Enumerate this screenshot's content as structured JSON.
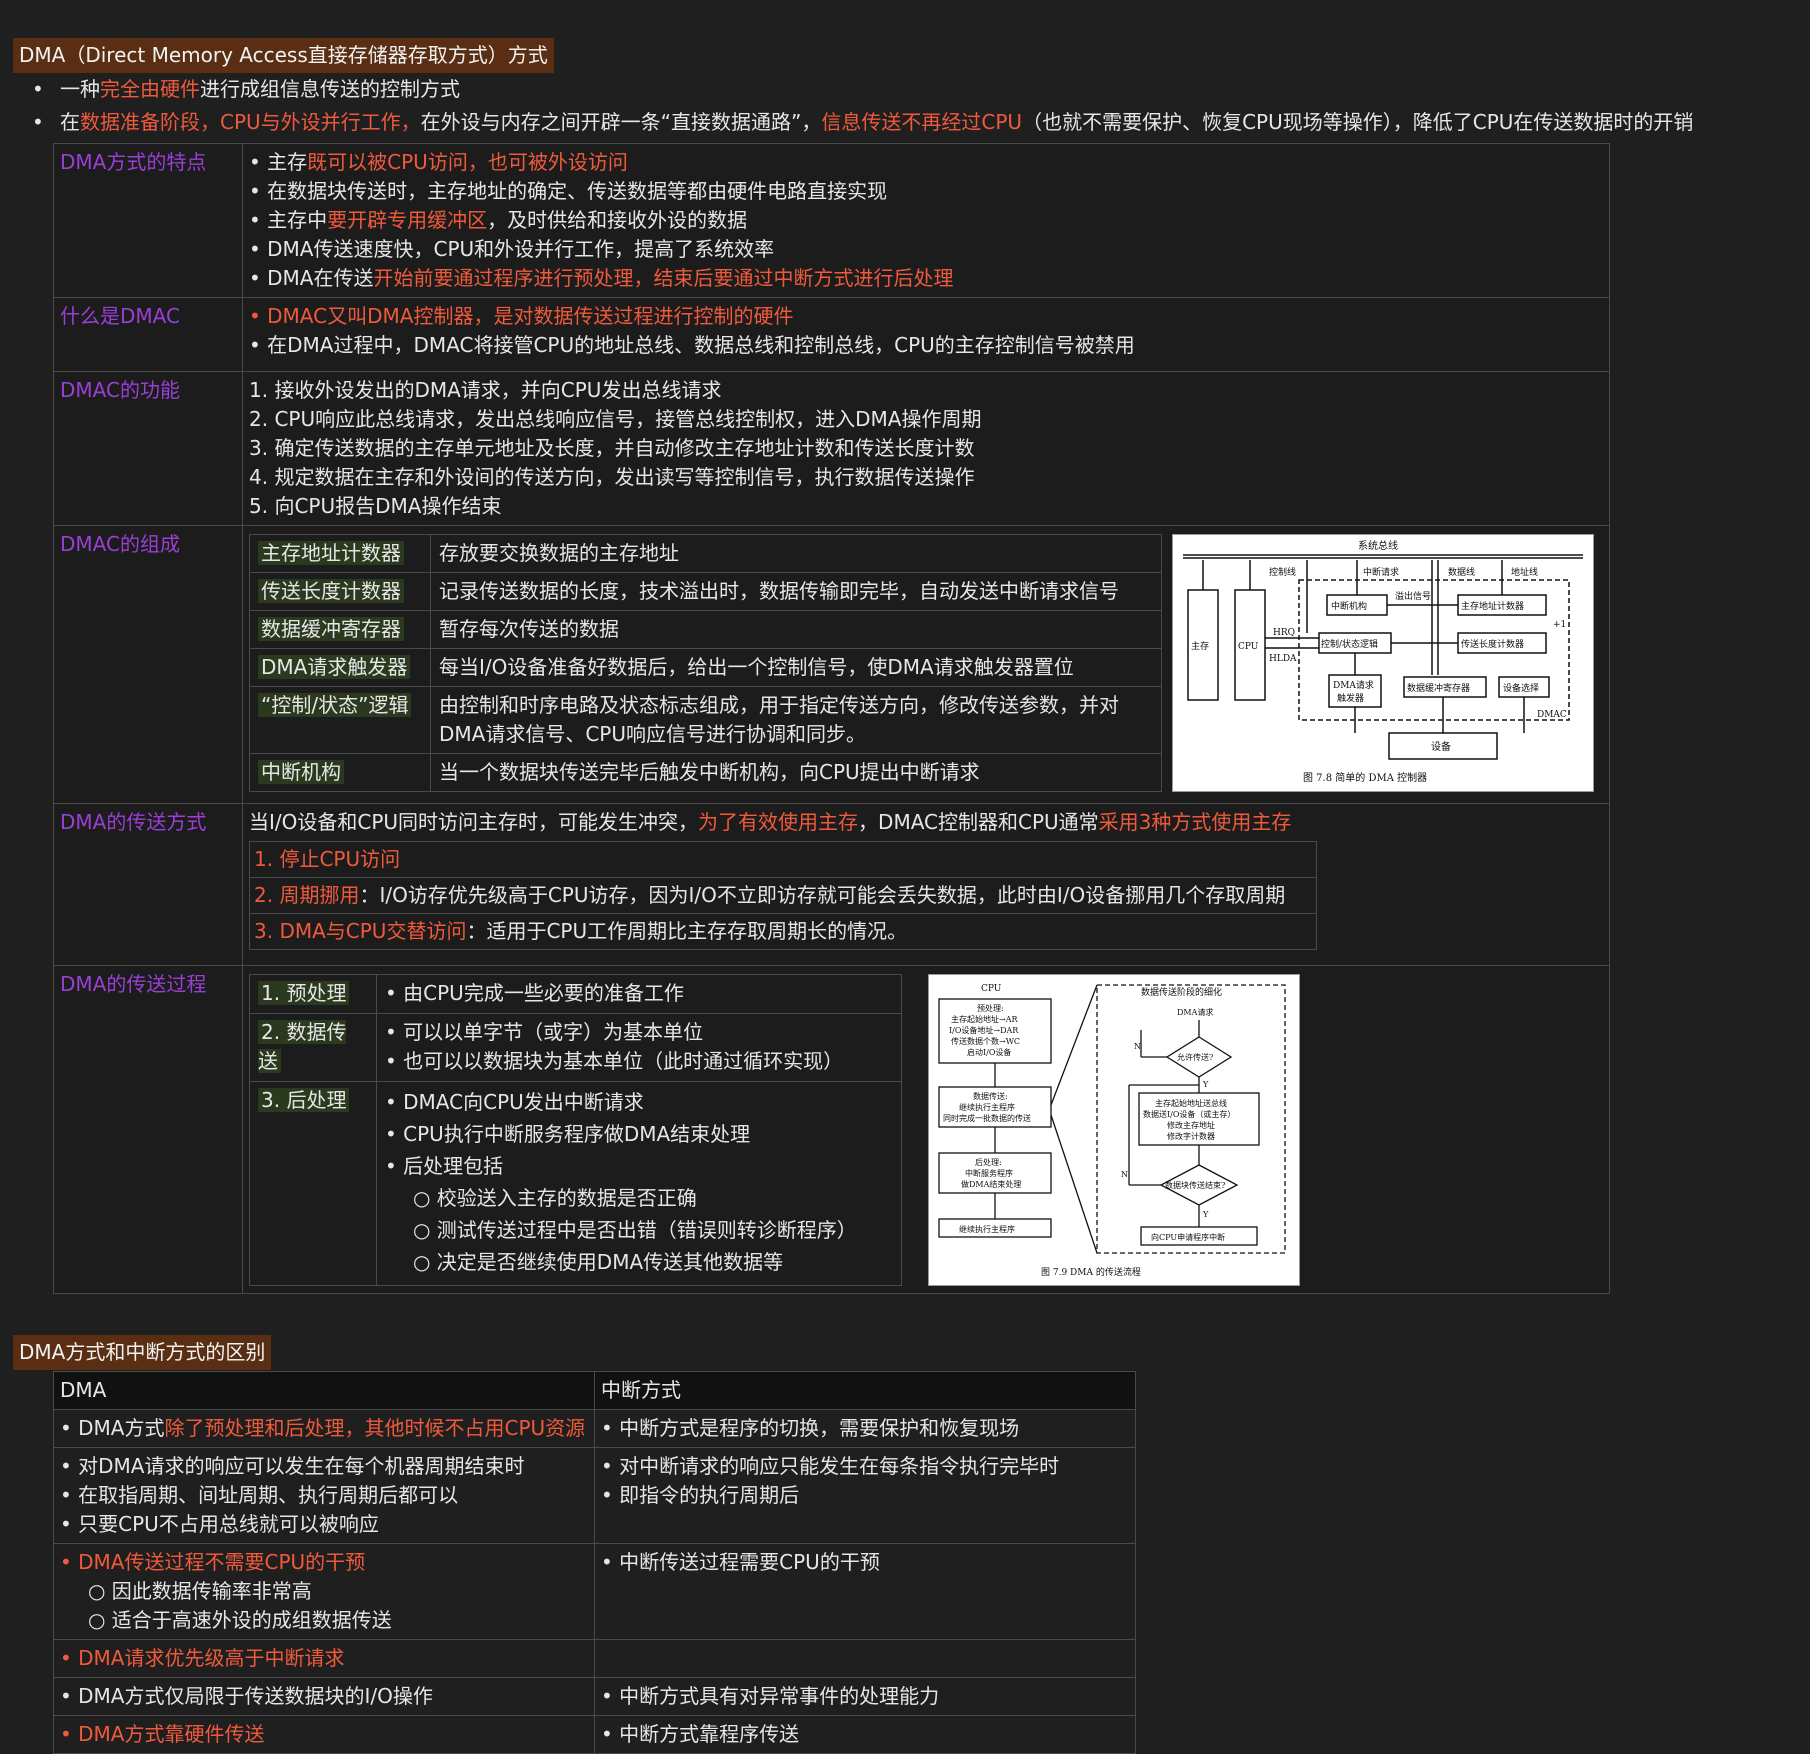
{
  "section1": {
    "title": "DMA（Direct Memory Access直接存储器存取方式）方式",
    "bullet1": {
      "a": "一种",
      "b": "完全由硬件",
      "c": "进行成组信息传送的控制方式"
    },
    "bullet2": {
      "a": "在",
      "b": "数据准备阶段，CPU与外设并行工作，",
      "c": "在外设与内存之间开辟一条“直接数据通路”，",
      "d": "信息传送不再经过CPU",
      "e": "（也就不需要保护、恢复CPU现场等操作），降低了CPU在传送数据时的开销"
    }
  },
  "rows": {
    "features": {
      "label": "DMA方式的特点",
      "l1a": "• 主存",
      "l1b": "既可以被CPU访问，也可被外设访问",
      "l2": "• 在数据块传送时，主存地址的确定、传送数据等都由硬件电路直接实现",
      "l3a": "• 主存中",
      "l3b": "要开辟专用缓冲区",
      "l3c": "，及时供给和接收外设的数据",
      "l4": "• DMA传送速度快，CPU和外设并行工作，提高了系统效率",
      "l5a": "• DMA在传送",
      "l5b": "开始前要通过程序进行预处理，结束后要通过中断方式进行后处理"
    },
    "dmac": {
      "label": "什么是DMAC",
      "l1": "• DMAC又叫DMA控制器，是对数据传送过程进行控制的硬件",
      "l2": "• 在DMA过程中，DMAC将接管CPU的地址总线、数据总线和控制总线，CPU的主存控制信号被禁用"
    },
    "function": {
      "label": "DMAC的功能",
      "items": [
        "1. 接收外设发出的DMA请求，并向CPU发出总线请求",
        "2. CPU响应此总线请求，发出总线响应信号，接管总线控制权，进入DMA操作周期",
        "3. 确定传送数据的主存单元地址及长度，并自动修改主存地址计数和传送长度计数",
        "4. 规定数据在主存和外设间的传送方向，发出读写等控制信号，执行数据传送操作",
        "5. 向CPU报告DMA操作结束"
      ]
    },
    "composition": {
      "label": "DMAC的组成",
      "parts": [
        {
          "name": "主存地址计数器",
          "desc": "存放要交换数据的主存地址"
        },
        {
          "name": "传送长度计数器",
          "desc": "记录传送数据的长度，技术溢出时，数据传输即完毕，自动发送中断请求信号"
        },
        {
          "name": "数据缓冲寄存器",
          "desc": "暂存每次传送的数据"
        },
        {
          "name": "DMA请求触发器",
          "desc": "每当I/O设备准备好数据后，给出一个控制信号，使DMA请求触发器置位"
        },
        {
          "name": "“控制/状态”逻辑",
          "desc": "由控制和时序电路及状态标志组成，用于指定传送方向，修改传送参数，并对DMA请求信号、CPU响应信号进行协调和同步。"
        },
        {
          "name": "中断机构",
          "desc": "当一个数据块传送完毕后触发中断机构，向CPU提出中断请求"
        }
      ],
      "fig": {
        "bus": "系统总线",
        "ctrl": "控制线",
        "irq": "中断请求",
        "data": "数据线",
        "addr": "地址线",
        "mem": "主存",
        "cpu": "CPU",
        "hrq": "HRQ",
        "hlda": "HLDA",
        "intr": "中断机构",
        "ovf": "溢出信号",
        "mac": "主存地址计数器",
        "ctl": "控制/状态逻辑",
        "len": "传送长度计数器",
        "plus": "+1",
        "req1": "DMA请求",
        "req2": "触发器",
        "buf": "数据缓冲寄存器",
        "sel": "设备选择",
        "dmac": "DMAC",
        "dev": "设备",
        "caption": "图 7.8    简单的 DMA 控制器"
      }
    },
    "modes": {
      "label": "DMA的传送方式",
      "introA": "当I/O设备和CPU同时访问主存时，可能发生冲突，",
      "introB": "为了有效使用主存",
      "introC": "，DMAC控制器和CPU通常",
      "introD": "采用3种方式使用主存",
      "m1": "1. 停止CPU访问",
      "m2a": "2. 周期挪用",
      "m2b": "：I/O访存优先级高于CPU访存，因为I/O不立即访存就可能会丢失数据，此时由I/O设备挪用几个存取周期",
      "m3a": "3. DMA与CPU交替访问",
      "m3b": "：适用于CPU工作周期比主存存取周期长的情况。"
    },
    "process": {
      "label": "DMA的传送过程",
      "s1": "1. 预处理",
      "s1d": "• 由CPU完成一些必要的准备工作",
      "s2": "2. 数据传送",
      "s2d1": "• 可以以单字节（或字）为基本单位",
      "s2d2": "• 也可以以数据块为基本单位（此时通过循环实现）",
      "s3": "3. 后处理",
      "s3d1": "• DMAC向CPU发出中断请求",
      "s3d2": "• CPU执行中断服务程序做DMA结束处理",
      "s3d3": "• 后处理包括",
      "s3s1": "○ 校验送入主存的数据是否正确",
      "s3s2": "○ 测试传送过程中是否出错（错误则转诊断程序）",
      "s3s3": "○ 决定是否继续使用DMA传送其他数据等",
      "fig": {
        "cpu": "CPU",
        "detail": "数据传送阶段的细化",
        "pre1": "预处理:",
        "pre2": "主存起始地址→AR",
        "pre3": "I/O设备地址→DAR",
        "pre4": "传送数据个数→WC",
        "pre5": "启动I/O设备",
        "dt1": "数据传送:",
        "dt2": "继续执行主程序",
        "dt3": "同时完成一批数据的传送",
        "post1": "后处理:",
        "post2": "中断服务程序",
        "post3": "做DMA结束处理",
        "cont": "继续执行主程序",
        "req": "DMA请求",
        "allow": "允许传送?",
        "n1": "N",
        "y1": "Y",
        "xf1": "主存起始地址送总线",
        "xf2": "数据送I/O设备（或主存）",
        "xf3": "修改主存地址",
        "xf4": "修改字计数器",
        "done": "数据块传送结束?",
        "n2": "N",
        "y2": "Y",
        "irq": "向CPU申请程序中断",
        "caption": "图 7.9    DMA 的传送流程"
      }
    }
  },
  "section2": {
    "title": "DMA方式和中断方式的区别",
    "head": {
      "dma": "DMA",
      "int": "中断方式"
    },
    "r1": {
      "dma_a": "• DMA方式",
      "dma_b": "除了预处理和后处理，其他时候不占用CPU资源",
      "int": "• 中断方式是程序的切换，需要保护和恢复现场"
    },
    "r2": {
      "dma1": "• 对DMA请求的响应可以发生在每个机器周期结束时",
      "dma2": "• 在取指周期、间址周期、执行周期后都可以",
      "dma3": "• 只要CPU不占用总线就可以被响应",
      "int1": "• 对中断请求的响应只能发生在每条指令执行完毕时",
      "int2": "• 即指令的执行周期后"
    },
    "r3": {
      "dma1": "• DMA传送过程不需要CPU的干预",
      "dma2": "○ 因此数据传输率非常高",
      "dma3": "○ 适合于高速外设的成组数据传送",
      "int": "• 中断传送过程需要CPU的干预"
    },
    "r4": {
      "dma": "• DMA请求优先级高于中断请求",
      "int": ""
    },
    "r5": {
      "dma": "• DMA方式仅局限于传送数据块的I/O操作",
      "int": "• 中断方式具有对异常事件的处理能力"
    },
    "r6": {
      "dma": "• DMA方式靠硬件传送",
      "int": "• 中断方式靠程序传送"
    }
  }
}
